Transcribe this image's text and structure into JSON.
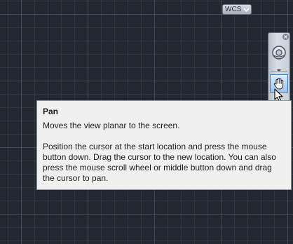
{
  "viewport": {
    "background_color": "#212830",
    "grid_major_color": "#505c6c",
    "grid_minor_color": "#3a4452"
  },
  "ucs_badge": {
    "label": "WCS",
    "menu_icon": "chevron-down-icon"
  },
  "navigation_bar": {
    "close_icon": "close-icon",
    "orbit_icon": "steering-wheel-icon",
    "dropdown_icon": "chevron-down-icon",
    "active_tool_icon": "pan-hand-icon",
    "active_highlight_color": "#9cc4ec"
  },
  "tooltip": {
    "title": "Pan",
    "summary": "Moves the view planar to the screen.",
    "detail": "Position the cursor at the start location and press the mouse button down. Drag the cursor to the new location. You can also press the mouse scroll wheel or middle button down and drag the cursor to pan."
  }
}
